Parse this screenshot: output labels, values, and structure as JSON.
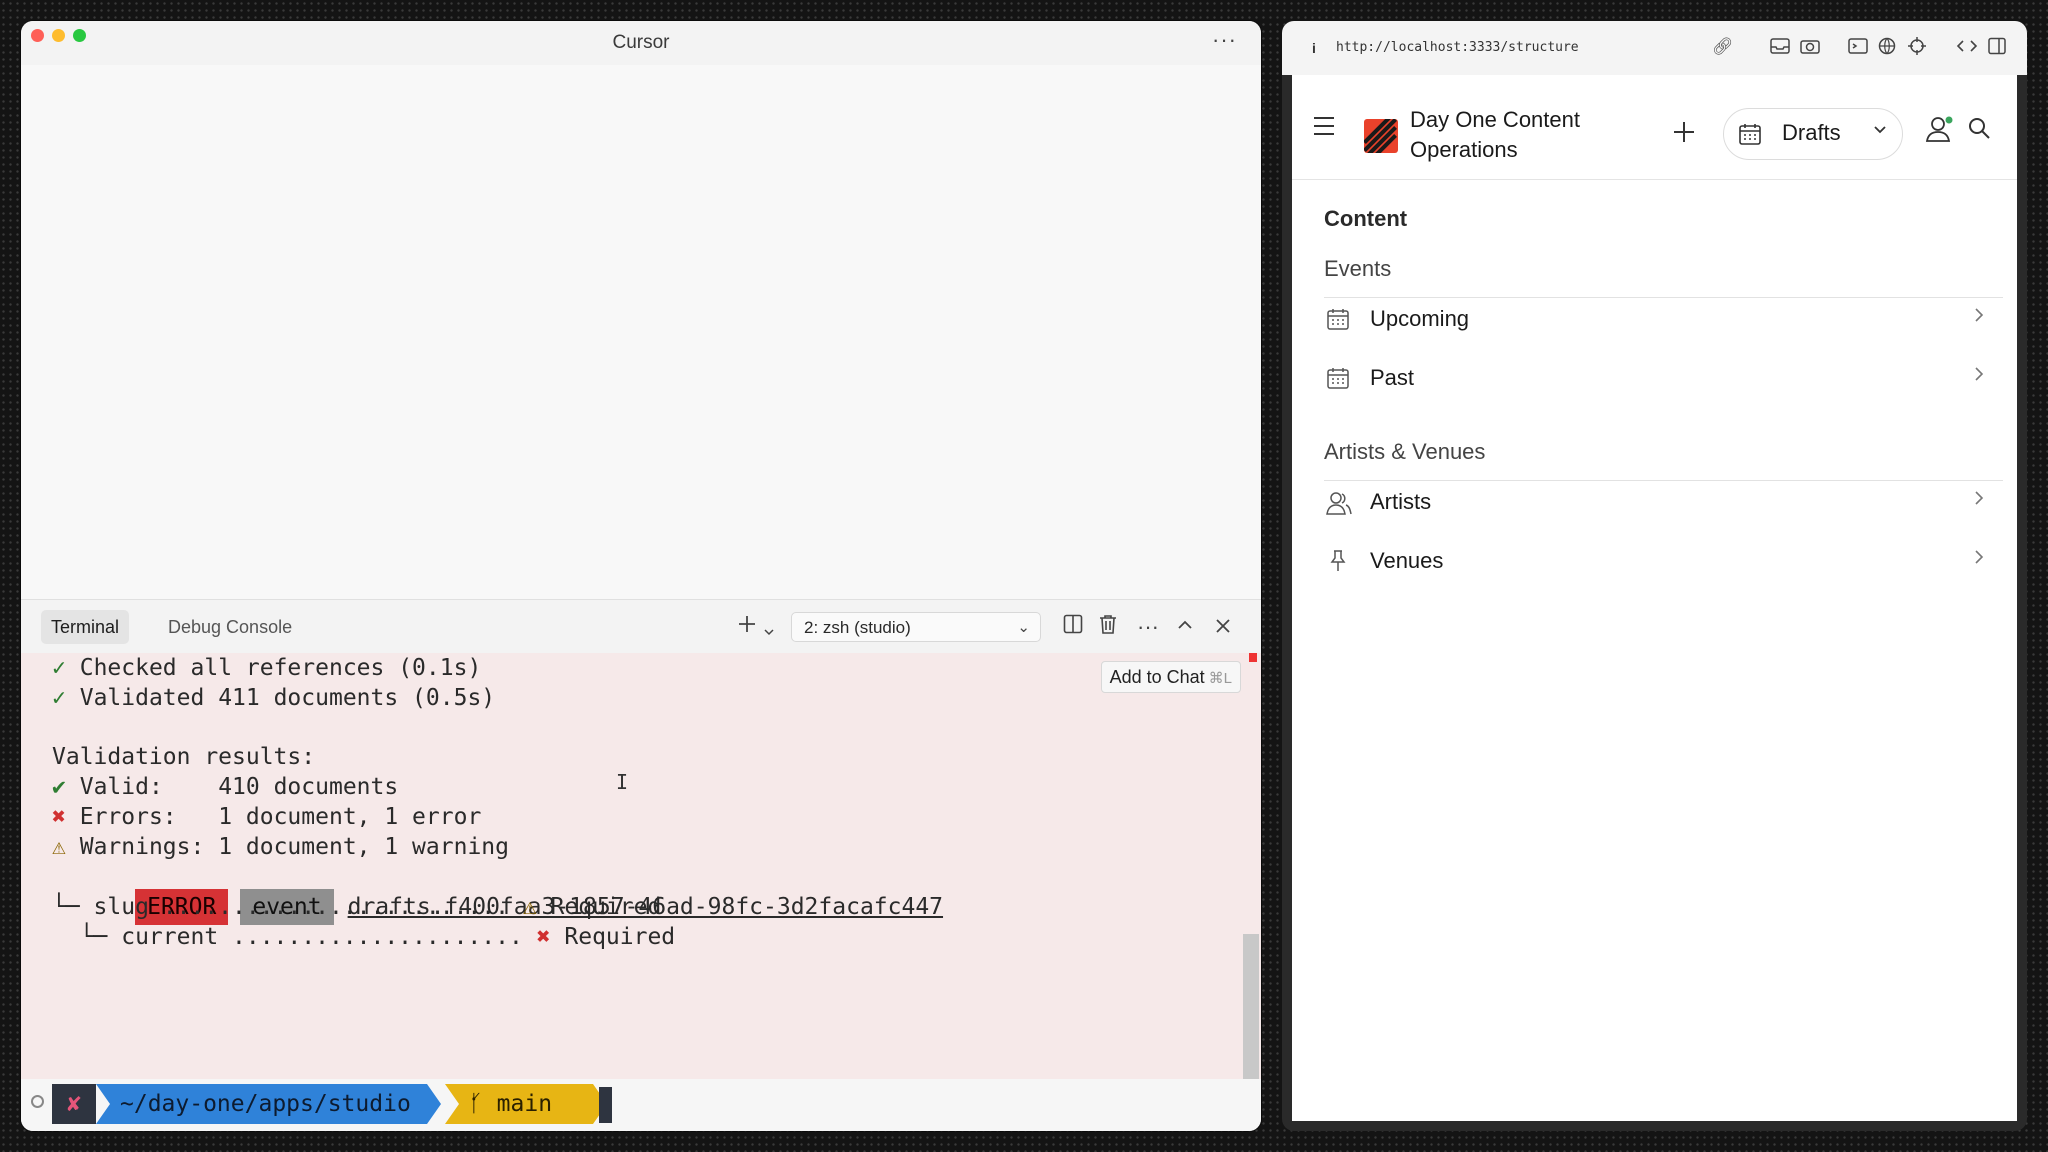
{
  "cursor_window": {
    "title": "Cursor",
    "menu_icon": "ellipsis-icon"
  },
  "panel": {
    "tabs": [
      "Terminal",
      "Debug Console"
    ],
    "shell_selected": "2: zsh (studio)",
    "icons": [
      "plus-icon",
      "chevron-down-icon",
      "split-icon",
      "trash-icon",
      "ellipsis-icon",
      "chevron-up-icon",
      "close-icon"
    ]
  },
  "terminal": {
    "add_to_chat": "Add to Chat",
    "add_to_chat_shortcut": "⌘L",
    "lines": {
      "checked_refs": "Checked all references (0.1s)",
      "validated": "Validated 411 documents (0.5s)",
      "results_header": "Validation results:",
      "valid": "Valid:    410 documents",
      "errors": "Errors:   1 document, 1 error",
      "warnings": "Warnings: 1 document, 1 warning",
      "badge_error": "ERROR",
      "badge_type": "event",
      "doc_id": "drafts.f400faa3-1857-46ad-98fc-3d2facafc447",
      "slug_field": "└─ slug ......................... ",
      "slug_status": "Required",
      "current_field": "  └─ current ..................... ",
      "current_status": "Required"
    },
    "prompt": {
      "status": "✘",
      "path": "~/day-one/apps/studio",
      "branch": "main"
    }
  },
  "browser": {
    "url_info": "i",
    "url": "http://localhost:3333/structure",
    "app_name": "Day One Content Operations",
    "perspective": "Drafts",
    "root_title": "Content",
    "sections": [
      {
        "title": "Events",
        "items": [
          {
            "label": "Upcoming",
            "icon": "calendar-icon"
          },
          {
            "label": "Past",
            "icon": "calendar-icon"
          }
        ]
      },
      {
        "title": "Artists & Venues",
        "items": [
          {
            "label": "Artists",
            "icon": "users-icon"
          },
          {
            "label": "Venues",
            "icon": "pin-icon"
          }
        ]
      }
    ],
    "colors": {
      "brand": "#e9422b",
      "error_badge": "#d63235",
      "prompt_path": "#2f82d9",
      "prompt_branch": "#e7b514"
    }
  }
}
